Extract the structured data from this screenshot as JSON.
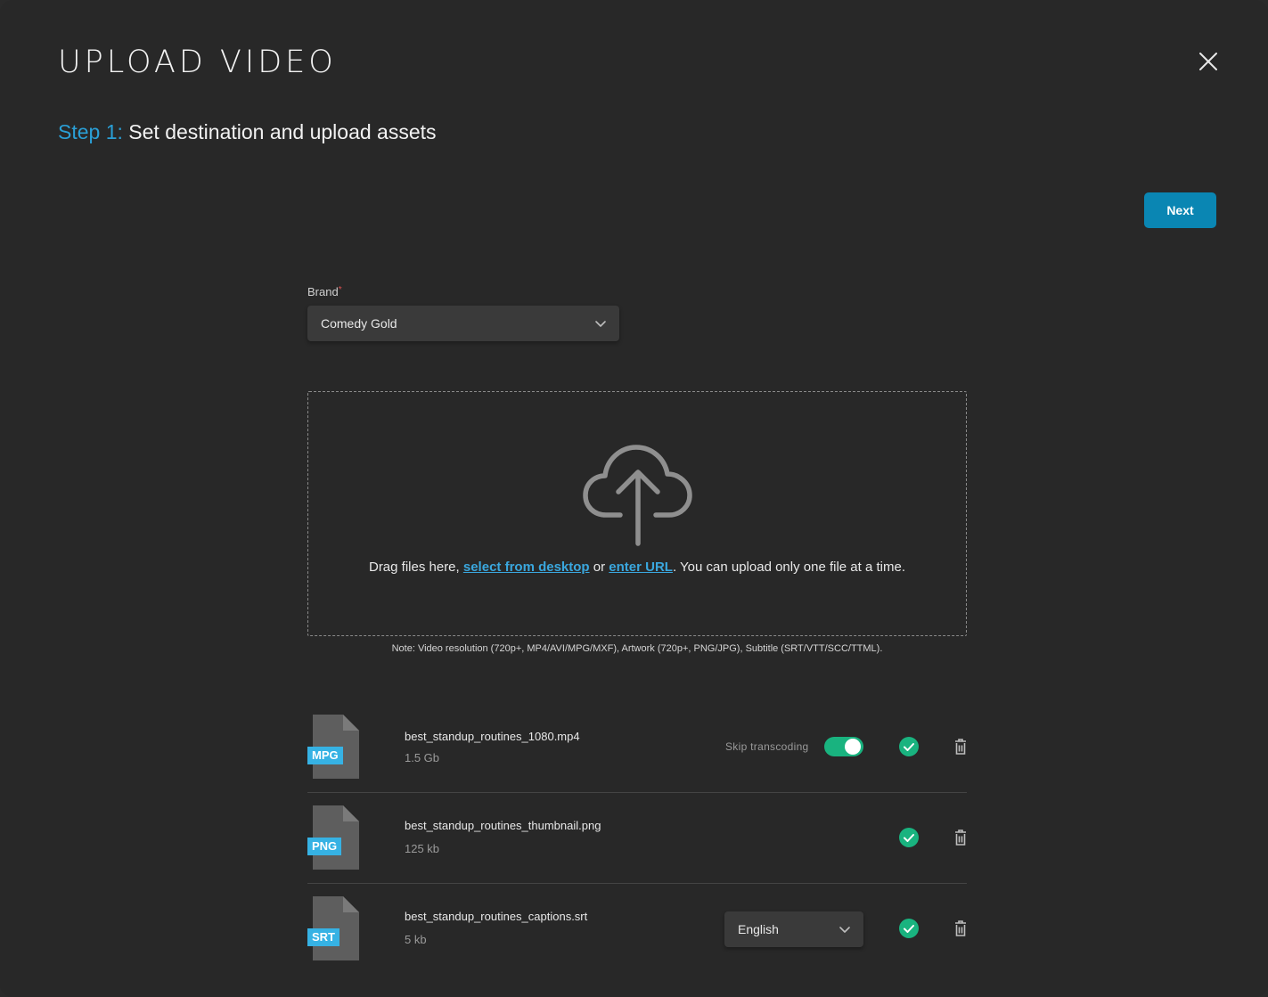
{
  "modal": {
    "title": "UPLOAD VIDEO",
    "close_icon": "close-icon"
  },
  "step": {
    "number": "Step 1:",
    "text": "Set destination and upload assets"
  },
  "actions": {
    "next_label": "Next",
    "accent_color": "#0a86b3"
  },
  "brand": {
    "label": "Brand",
    "required_mark": "*",
    "selected": "Comedy Gold"
  },
  "dropzone": {
    "icon": "cloud-upload-icon",
    "text_before": "Drag files here, ",
    "link_desktop": "select from desktop",
    "text_or": " or ",
    "link_url": "enter URL",
    "text_after": ". You can upload only one file at a time.",
    "note": "Note: Video resolution (720p+, MP4/AVI/MPG/MXF), Artwork (720p+, PNG/JPG), Subtitle (SRT/VTT/SCC/TTML)."
  },
  "files": [
    {
      "type_tag": "MPG",
      "name": "best_standup_routines_1080.mp4",
      "size": "1.5 Gb",
      "skip_label": "Skip transcoding",
      "skip_enabled": true,
      "status": "check-icon"
    },
    {
      "type_tag": "PNG",
      "name": "best_standup_routines_thumbnail.png",
      "size": "125 kb",
      "status": "check-icon"
    },
    {
      "type_tag": "SRT",
      "name": "best_standup_routines_captions.srt",
      "size": "5 kb",
      "language": "English",
      "status": "check-icon"
    }
  ],
  "colors": {
    "link": "#3aa7de",
    "success": "#19b37f",
    "tag": "#36b2e4"
  }
}
